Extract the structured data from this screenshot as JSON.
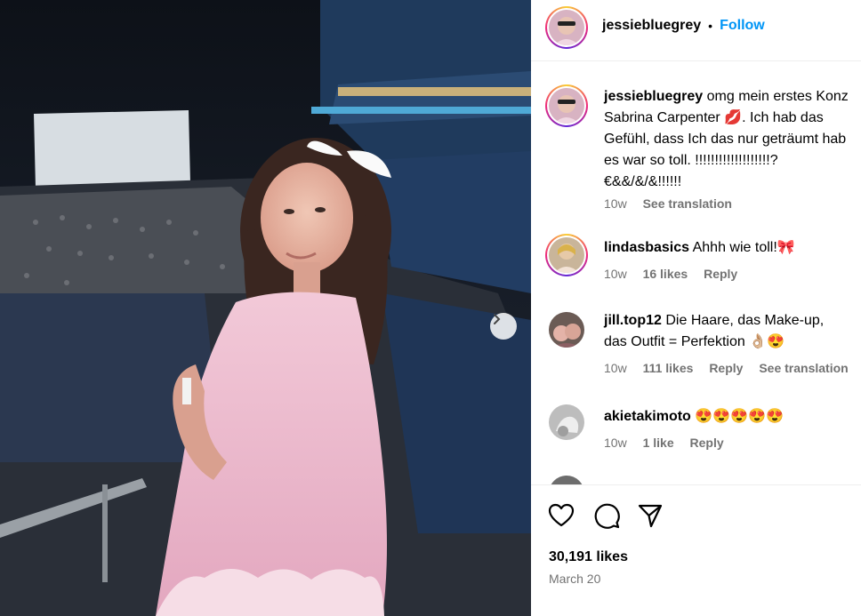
{
  "post": {
    "author": "jessiebluegrey",
    "follow_label": "Follow",
    "caption_lines": [
      "omg mein erstes Konz",
      "Sabrina Carpenter 💋. Ich hab das",
      "Gefühl, dass Ich das nur geträumt hab",
      "es war so toll. !!!!!!!!!!!!!!!!!!!?",
      "€&&/&/&!!!!!!"
    ],
    "caption_age": "10w",
    "caption_translate": "See translation"
  },
  "comments": [
    {
      "user": "lindasbasics",
      "text": "Ahhh wie toll!🎀",
      "age": "10w",
      "likes": "16 likes",
      "reply": "Reply",
      "translate": ""
    },
    {
      "user": "jill.top12",
      "text": "Die Haare, das Make-up,",
      "text2": "das Outfit = Perfektion 👌🏼😍",
      "age": "10w",
      "likes": "111 likes",
      "reply": "Reply",
      "translate": "See translation"
    },
    {
      "user": "akietakimoto",
      "text": "😍😍😍😍😍",
      "age": "10w",
      "likes": "1 like",
      "reply": "Reply",
      "translate": ""
    }
  ],
  "footer": {
    "likes": "30,191 likes",
    "date": "March 20"
  },
  "separator": "•",
  "icons": {
    "like": "heart-icon",
    "comment": "comment-icon",
    "share": "share-icon",
    "next": "chevron-right-icon"
  },
  "colors": {
    "link_blue": "#0095f6",
    "muted": "#737373"
  }
}
